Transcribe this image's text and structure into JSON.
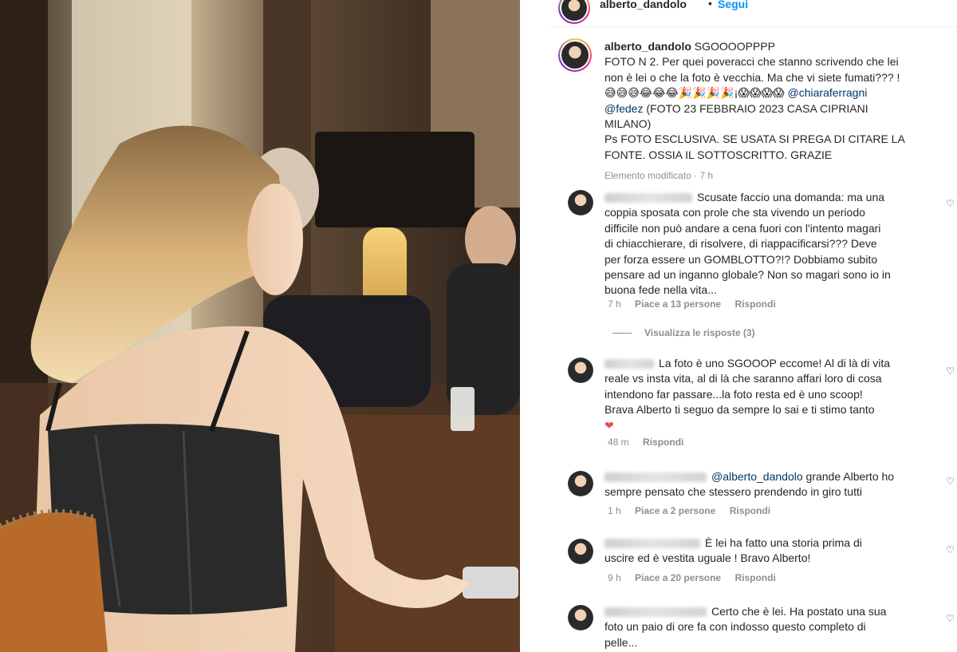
{
  "header": {
    "username": "alberto_dandolo",
    "separator": "•",
    "follow_label": "Segui"
  },
  "caption": {
    "username": "alberto_dandolo",
    "line1": "SGOOOOPPPP",
    "line2": "FOTO N 2. Per quei poveracci che stanno scrivendo che lei",
    "line3": "non è lei o che la foto è vecchia. Ma che vi siete fumati??? !",
    "emojis": "😅😅😅😂😂😂🎉🎉🎉🎉¡😱😱😱😱",
    "mention1": "@chiaraferragni",
    "mention2": "@fedez",
    "line4b": "(FOTO 23 FEBBRAIO 2023 CASA CIPRIANI",
    "line5": "MILANO)",
    "line6": "Ps FOTO ESCLUSIVA. SE USATA SI PREGA DI CITARE LA",
    "line7": "FONTE. OSSIA IL SOTTOSCRITTO. GRAZIE",
    "edited": "Elemento modificato · 7 h"
  },
  "comments": [
    {
      "lines": [
        "Scusate faccio una domanda: ma una",
        "coppia sposata con prole che sta vivendo un periodo",
        "difficile non può andare a cena fuori con l'intento magari",
        "di chiacchierare, di risolvere, di riappacificarsi??? Deve",
        "per forza essere un GOMBLOTTO?!? Dobbiamo subito",
        "pensare ad un inganno globale? Non so magari sono io in",
        "buona fede nella vita..."
      ],
      "time": "7 h",
      "likes": "Piace a 13 persone",
      "reply": "Rispondi",
      "view_replies": "Visualizza le risposte (3)"
    },
    {
      "lines": [
        "La foto è uno SGOOOP eccome! Al di là di vita",
        "reale vs insta vita, al di là che saranno affari loro di cosa",
        "intendono far passare...la foto resta ed è uno scoop!",
        "Brava Alberto ti seguo da sempre lo sai e ti stimo tanto"
      ],
      "heart": "❤",
      "time": "48 m",
      "reply": "Rispondi"
    },
    {
      "mention": "@alberto_dandolo",
      "lines": [
        "grande Alberto ho",
        "sempre pensato che stessero prendendo in giro tutti"
      ],
      "time": "1 h",
      "likes": "Piace a 2 persone",
      "reply": "Rispondi"
    },
    {
      "lines": [
        "È lei ha fatto una storia prima di",
        "uscire ed è vestita uguale ! Bravo Alberto!"
      ],
      "time": "9 h",
      "likes": "Piace a 20 persone",
      "reply": "Rispondi"
    },
    {
      "lines": [
        "Certo che è lei. Ha postato una sua",
        "foto un paio di ore fa con indosso questo completo di",
        "pelle..."
      ]
    }
  ],
  "icons": {
    "like": "heart-outline-icon"
  }
}
